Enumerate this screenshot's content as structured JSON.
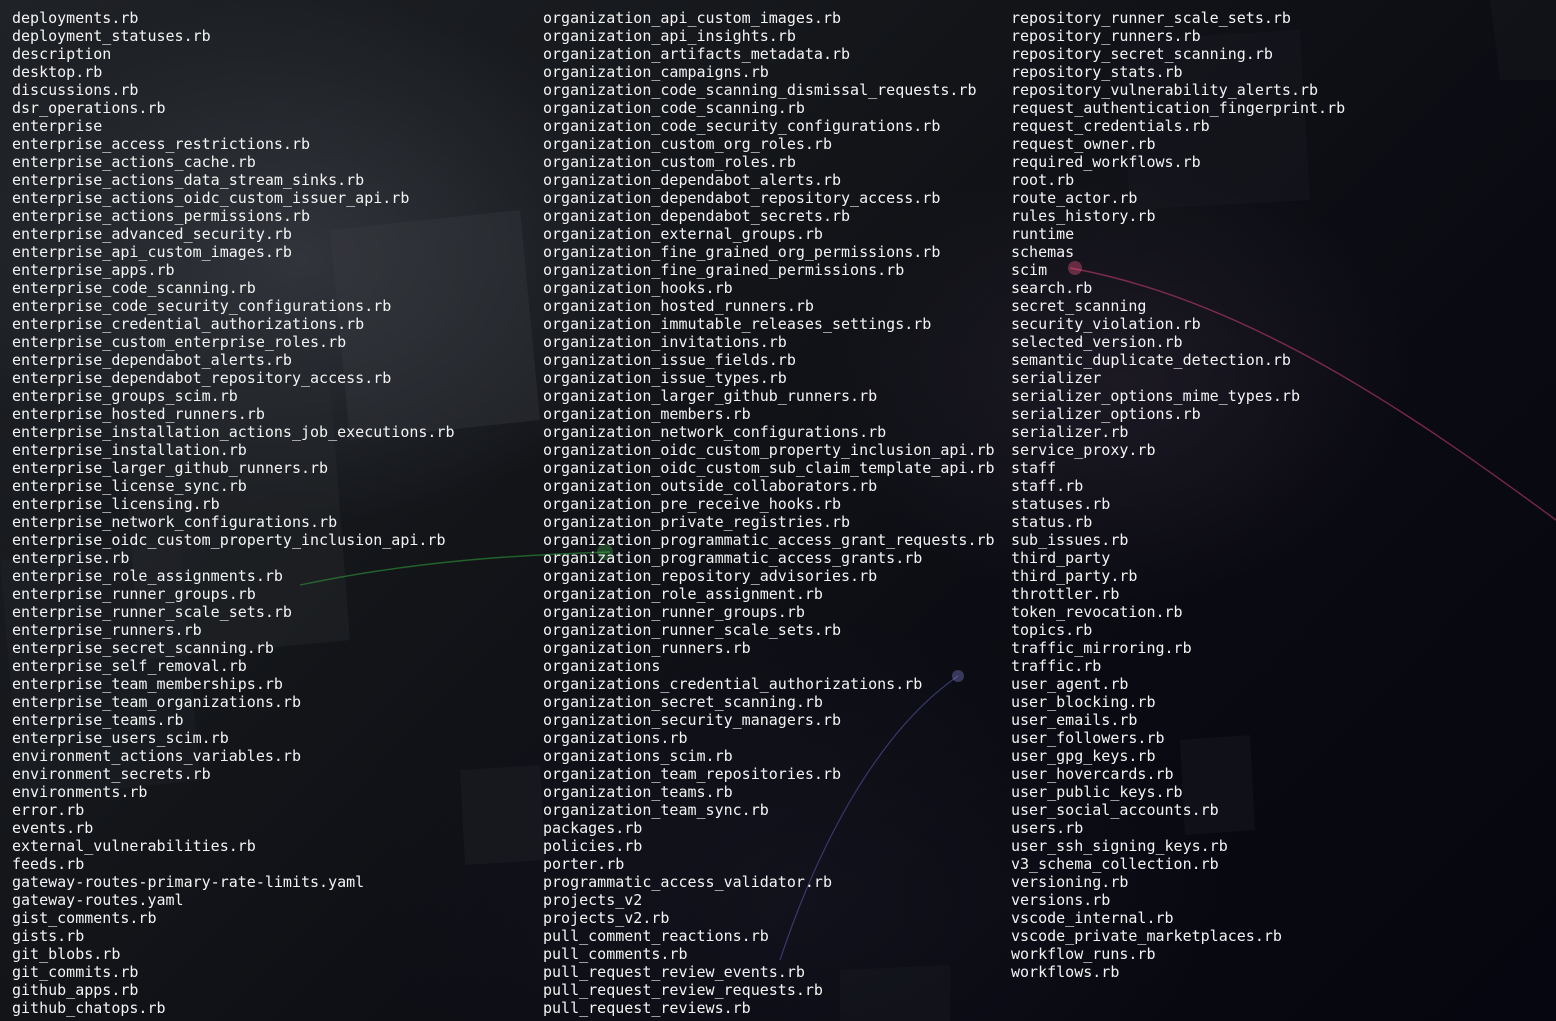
{
  "columns": [
    [
      "deployments.rb",
      "deployment_statuses.rb",
      "description",
      "desktop.rb",
      "discussions.rb",
      "dsr_operations.rb",
      "enterprise",
      "enterprise_access_restrictions.rb",
      "enterprise_actions_cache.rb",
      "enterprise_actions_data_stream_sinks.rb",
      "enterprise_actions_oidc_custom_issuer_api.rb",
      "enterprise_actions_permissions.rb",
      "enterprise_advanced_security.rb",
      "enterprise_api_custom_images.rb",
      "enterprise_apps.rb",
      "enterprise_code_scanning.rb",
      "enterprise_code_security_configurations.rb",
      "enterprise_credential_authorizations.rb",
      "enterprise_custom_enterprise_roles.rb",
      "enterprise_dependabot_alerts.rb",
      "enterprise_dependabot_repository_access.rb",
      "enterprise_groups_scim.rb",
      "enterprise_hosted_runners.rb",
      "enterprise_installation_actions_job_executions.rb",
      "enterprise_installation.rb",
      "enterprise_larger_github_runners.rb",
      "enterprise_license_sync.rb",
      "enterprise_licensing.rb",
      "enterprise_network_configurations.rb",
      "enterprise_oidc_custom_property_inclusion_api.rb",
      "enterprise.rb",
      "enterprise_role_assignments.rb",
      "enterprise_runner_groups.rb",
      "enterprise_runner_scale_sets.rb",
      "enterprise_runners.rb",
      "enterprise_secret_scanning.rb",
      "enterprise_self_removal.rb",
      "enterprise_team_memberships.rb",
      "enterprise_team_organizations.rb",
      "enterprise_teams.rb",
      "enterprise_users_scim.rb",
      "environment_actions_variables.rb",
      "environment_secrets.rb",
      "environments.rb",
      "error.rb",
      "events.rb",
      "external_vulnerabilities.rb",
      "feeds.rb",
      "gateway-routes-primary-rate-limits.yaml",
      "gateway-routes.yaml",
      "gist_comments.rb",
      "gists.rb",
      "git_blobs.rb",
      "git_commits.rb",
      "github_apps.rb",
      "github_chatops.rb"
    ],
    [
      "organization_api_custom_images.rb",
      "organization_api_insights.rb",
      "organization_artifacts_metadata.rb",
      "organization_campaigns.rb",
      "organization_code_scanning_dismissal_requests.rb",
      "organization_code_scanning.rb",
      "organization_code_security_configurations.rb",
      "organization_custom_org_roles.rb",
      "organization_custom_roles.rb",
      "organization_dependabot_alerts.rb",
      "organization_dependabot_repository_access.rb",
      "organization_dependabot_secrets.rb",
      "organization_external_groups.rb",
      "organization_fine_grained_org_permissions.rb",
      "organization_fine_grained_permissions.rb",
      "organization_hooks.rb",
      "organization_hosted_runners.rb",
      "organization_immutable_releases_settings.rb",
      "organization_invitations.rb",
      "organization_issue_fields.rb",
      "organization_issue_types.rb",
      "organization_larger_github_runners.rb",
      "organization_members.rb",
      "organization_network_configurations.rb",
      "organization_oidc_custom_property_inclusion_api.rb",
      "organization_oidc_custom_sub_claim_template_api.rb",
      "organization_outside_collaborators.rb",
      "organization_pre_receive_hooks.rb",
      "organization_private_registries.rb",
      "organization_programmatic_access_grant_requests.rb",
      "organization_programmatic_access_grants.rb",
      "organization_repository_advisories.rb",
      "organization_role_assignment.rb",
      "organization_runner_groups.rb",
      "organization_runner_scale_sets.rb",
      "organization_runners.rb",
      "organizations",
      "organizations_credential_authorizations.rb",
      "organization_secret_scanning.rb",
      "organization_security_managers.rb",
      "organizations.rb",
      "organizations_scim.rb",
      "organization_team_repositories.rb",
      "organization_teams.rb",
      "organization_team_sync.rb",
      "packages.rb",
      "policies.rb",
      "porter.rb",
      "programmatic_access_validator.rb",
      "projects_v2",
      "projects_v2.rb",
      "pull_comment_reactions.rb",
      "pull_comments.rb",
      "pull_request_review_events.rb",
      "pull_request_review_requests.rb",
      "pull_request_reviews.rb"
    ],
    [
      "repository_runner_scale_sets.rb",
      "repository_runners.rb",
      "repository_secret_scanning.rb",
      "repository_stats.rb",
      "repository_vulnerability_alerts.rb",
      "request_authentication_fingerprint.rb",
      "request_credentials.rb",
      "request_owner.rb",
      "required_workflows.rb",
      "root.rb",
      "route_actor.rb",
      "rules_history.rb",
      "runtime",
      "schemas",
      "scim",
      "search.rb",
      "secret_scanning",
      "security_violation.rb",
      "selected_version.rb",
      "semantic_duplicate_detection.rb",
      "serializer",
      "serializer_options_mime_types.rb",
      "serializer_options.rb",
      "serializer.rb",
      "service_proxy.rb",
      "staff",
      "staff.rb",
      "statuses.rb",
      "status.rb",
      "sub_issues.rb",
      "third_party",
      "third_party.rb",
      "throttler.rb",
      "token_revocation.rb",
      "topics.rb",
      "traffic_mirroring.rb",
      "traffic.rb",
      "user_agent.rb",
      "user_blocking.rb",
      "user_emails.rb",
      "user_followers.rb",
      "user_gpg_keys.rb",
      "user_hovercards.rb",
      "user_public_keys.rb",
      "user_social_accounts.rb",
      "users.rb",
      "user_ssh_signing_keys.rb",
      "v3_schema_collection.rb",
      "versioning.rb",
      "versions.rb",
      "vscode_internal.rb",
      "vscode_private_marketplaces.rb",
      "workflow_runs.rb",
      "workflows.rb"
    ]
  ]
}
